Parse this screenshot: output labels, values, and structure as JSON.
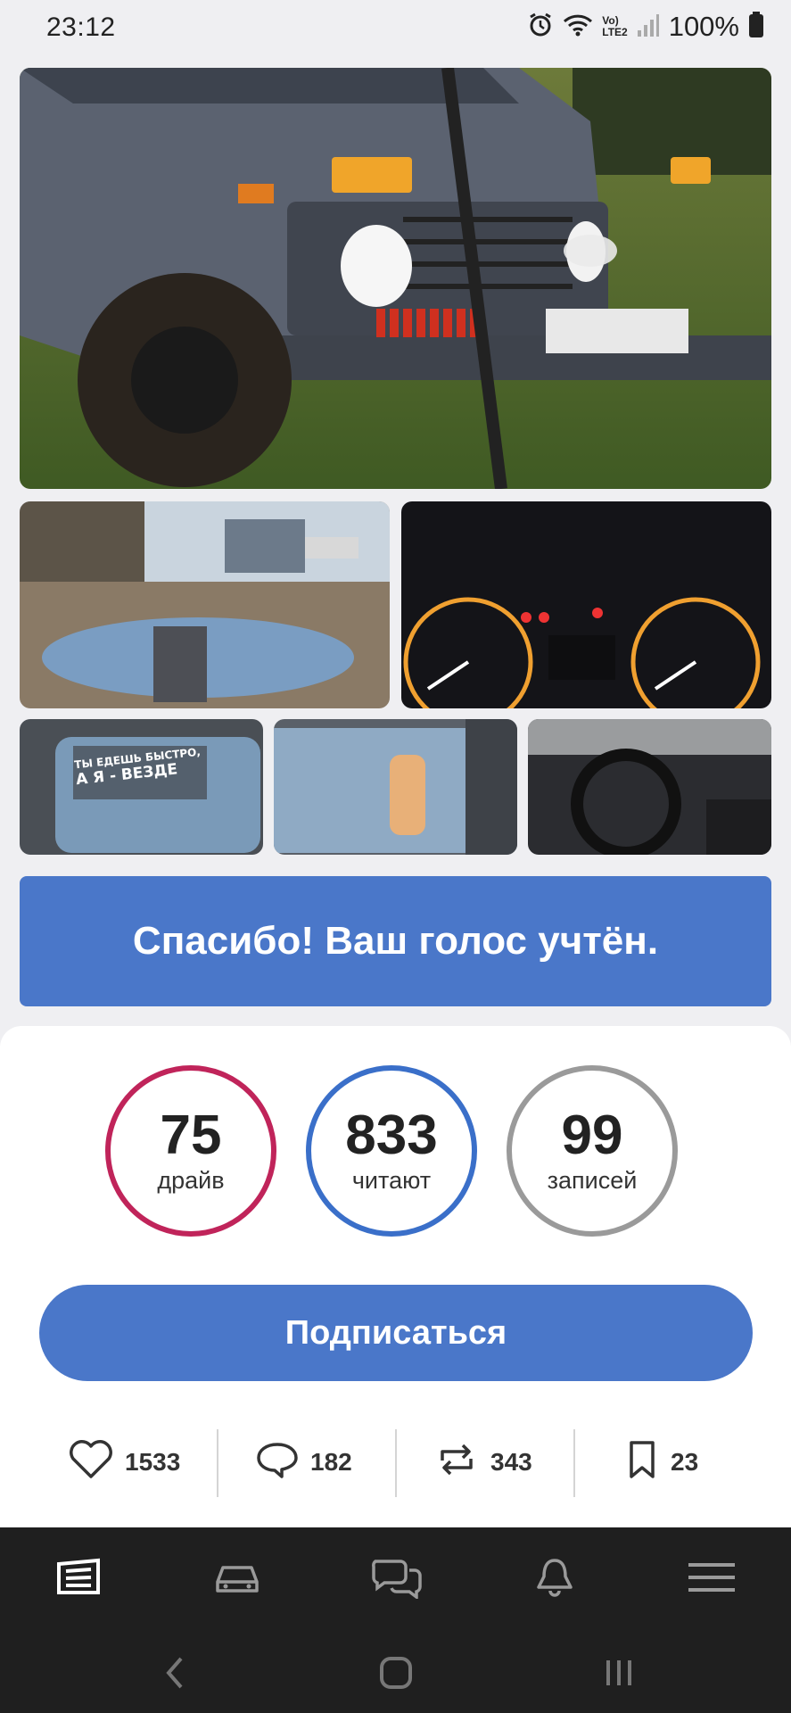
{
  "status_bar": {
    "time": "23:12",
    "network": "LTE2",
    "carrier_mark": "Vo)",
    "battery": "100%"
  },
  "photos": [
    {
      "name": "main-photo",
      "icon": "car-photo"
    },
    {
      "name": "puddle-photo",
      "icon": "puddle-photo"
    },
    {
      "name": "dashboard-photo",
      "icon": "dashboard-photo"
    },
    {
      "name": "window-sticker-photo",
      "icon": "sticker-photo"
    },
    {
      "name": "hand-sticker-photo",
      "icon": "sticker-photo"
    },
    {
      "name": "interior-photo",
      "icon": "interior-photo"
    }
  ],
  "sticker_text": {
    "line1": "ТЫ ЕДЕШЬ БЫСТРО,",
    "line2": "А Я - ВЕЗДЕ"
  },
  "vote_banner": "Спасибо! Ваш голос учтён.",
  "stats": [
    {
      "value": "75",
      "label": "драйв",
      "color": "#c0245a"
    },
    {
      "value": "833",
      "label": "читают",
      "color": "#3a6fc9"
    },
    {
      "value": "99",
      "label": "записей",
      "color": "#9a9a9a"
    }
  ],
  "subscribe_button": "Подписаться",
  "actions": {
    "likes": "1533",
    "comments": "182",
    "reposts": "343",
    "bookmarks": "23"
  },
  "bottom_nav": [
    "feed-icon",
    "car-icon",
    "messages-icon",
    "notifications-icon",
    "menu-icon"
  ],
  "colors": {
    "accent": "#4a77c9",
    "nav_bg": "#1f1f1f"
  }
}
